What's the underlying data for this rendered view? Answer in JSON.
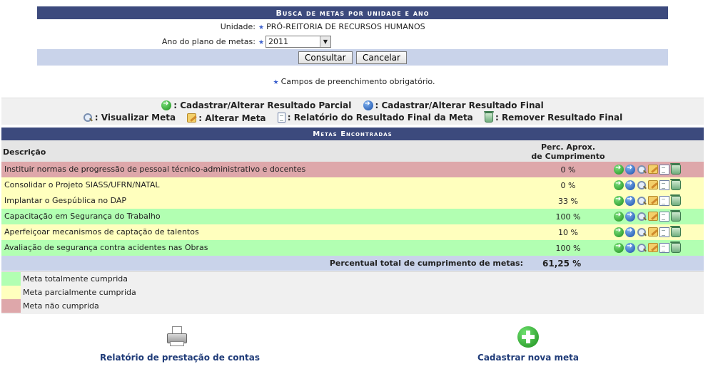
{
  "search_form": {
    "title": "Busca de metas por unidade e ano",
    "unidade_label": "Unidade:",
    "unidade_value": "PRÓ-REITORIA DE RECURSOS HUMANOS",
    "ano_label": "Ano do plano de metas:",
    "ano_value": "2011",
    "consultar_label": "Consultar",
    "cancelar_label": "Cancelar",
    "required_marker": "★"
  },
  "required_note": "Campos de preenchimento obrigatório.",
  "legend": {
    "parcial": ": Cadastrar/Alterar Resultado Parcial",
    "final": ": Cadastrar/Alterar Resultado Final",
    "visualizar": ": Visualizar Meta",
    "alterar": ": Alterar Meta",
    "relatorio": ": Relatório do Resultado Final da Meta",
    "remover": ": Remover Resultado Final"
  },
  "results": {
    "title": "Metas Encontradas",
    "col_descricao": "Descrição",
    "col_perc_line1": "Perc. Aprox.",
    "col_perc_line2": "de Cumprimento",
    "rows": [
      {
        "descricao": "Instituir normas de progressão de pessoal técnico-administrativo e docentes",
        "perc": "0 %",
        "status": "red"
      },
      {
        "descricao": "Consolidar o Projeto SIASS/UFRN/NATAL",
        "perc": "0 %",
        "status": "yellow"
      },
      {
        "descricao": "Implantar o Gespública no DAP",
        "perc": "33 %",
        "status": "yellow"
      },
      {
        "descricao": "Capacitação em Segurança do Trabalho",
        "perc": "100 %",
        "status": "green"
      },
      {
        "descricao": "Aperfeiçoar mecanismos de captação de talentos",
        "perc": "10 %",
        "status": "yellow"
      },
      {
        "descricao": "Avaliação de segurança contra acidentes nas Obras",
        "perc": "100 %",
        "status": "green"
      }
    ],
    "total_label": "Percentual total de cumprimento de metas:",
    "total_value": "61,25 %"
  },
  "status_legend": [
    {
      "label": "Meta totalmente cumprida",
      "color": "#b2ffb2"
    },
    {
      "label": "Meta parcialmente cumprida",
      "color": "#ffffbe"
    },
    {
      "label": "Meta não cumprida",
      "color": "#dea7aa"
    }
  ],
  "footer_actions": {
    "relatorio": "Relatório de prestação de contas",
    "cadastrar": "Cadastrar nova meta"
  },
  "colors": {
    "header_bg": "#3c4a7d",
    "form_footer_bg": "#c9d3ea",
    "row_red": "#dea7aa",
    "row_yellow": "#ffffbe",
    "row_green": "#b2ffb2"
  },
  "icons": [
    "green-arrow-icon",
    "blue-arrow-icon",
    "magnifier-icon",
    "edit-icon",
    "report-icon",
    "trash-icon",
    "printer-icon",
    "plus-icon"
  ]
}
